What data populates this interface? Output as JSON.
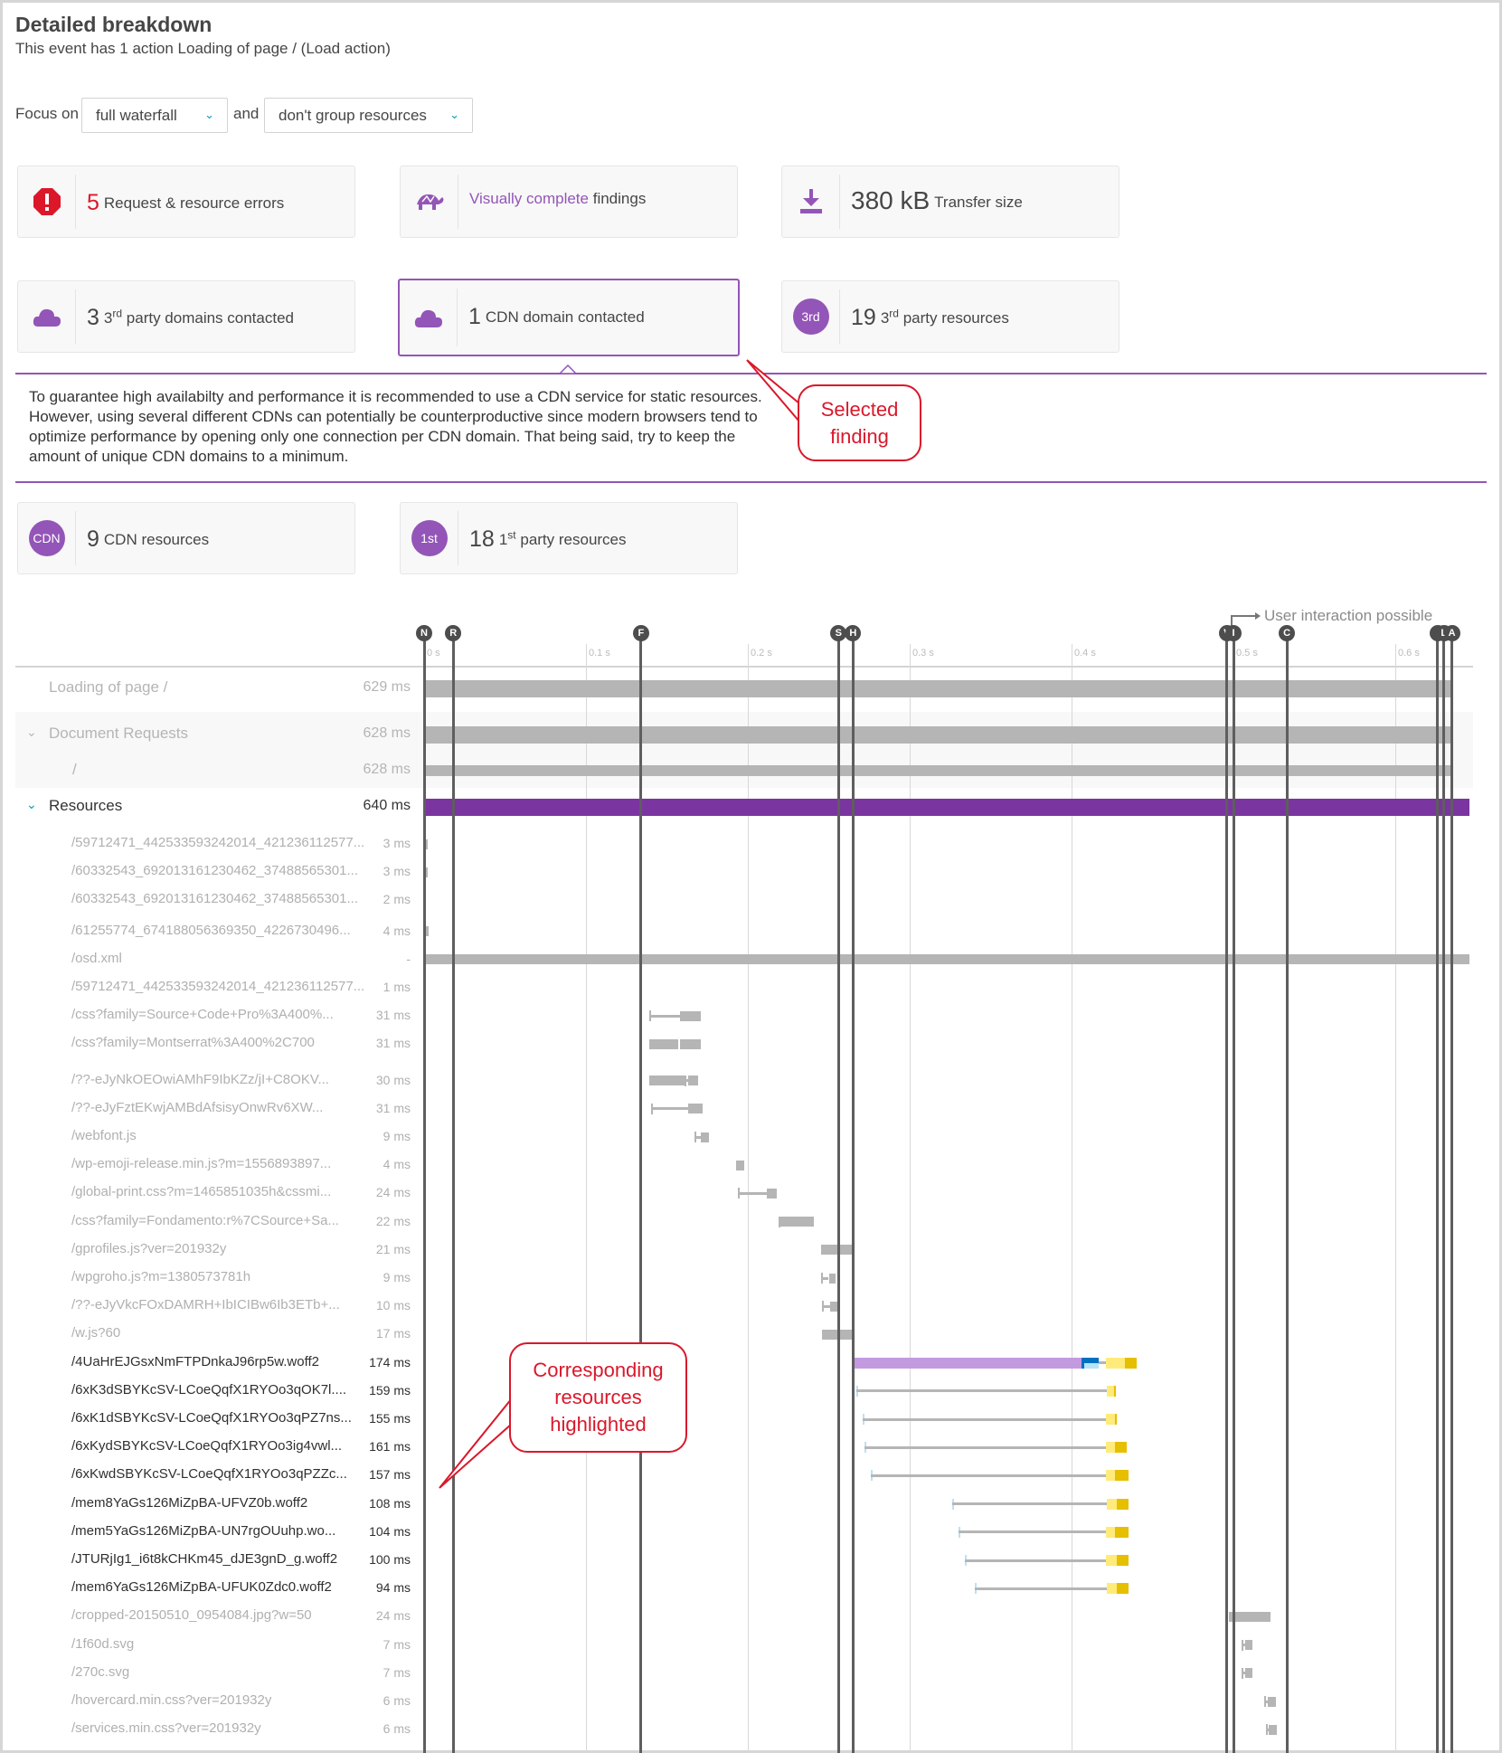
{
  "header": {
    "title": "Detailed breakdown",
    "subtitle": "This event has 1 action Loading of page / (Load action)"
  },
  "focus": {
    "label": "Focus on",
    "select1": "full waterfall",
    "and_label": "and",
    "select2": "don't group resources"
  },
  "cards": {
    "errors": {
      "value": "5",
      "label": "Request & resource errors",
      "icon": "error-octagon-icon"
    },
    "visually": {
      "link": "Visually complete",
      "label": "findings",
      "icon": "turtle-icon"
    },
    "transfer": {
      "value": "380 kB",
      "label": "Transfer size",
      "icon": "download-icon"
    },
    "third_domains": {
      "value": "3",
      "sup_num": "3",
      "sup": "rd",
      "label": "party domains contacted",
      "icon": "cloud-icon"
    },
    "cdn_domain": {
      "value": "1",
      "label": "CDN domain contacted",
      "icon": "cloud-icon",
      "selected": true
    },
    "third_resources": {
      "badge": "3rd",
      "value": "19",
      "sup_num": "3",
      "sup": "rd",
      "label": "party resources"
    },
    "cdn_resources": {
      "badge": "CDN",
      "value": "9",
      "label": "CDN resources"
    },
    "first_resources": {
      "badge": "1st",
      "value": "18",
      "sup_num": "1",
      "sup": "st",
      "label": "party resources"
    }
  },
  "finding_description": "To guarantee high availabilty and performance it is recommended to use a CDN service for static resources. However, using several different CDNs can potentially be counterproductive since modern browsers tend to optimize performance by opening only one connection per CDN domain. That being said, try to keep the amount of unique CDN domains to a minimum.",
  "callouts": {
    "selected": "Selected finding",
    "resources": "Corresponding resources highlighted"
  },
  "colors": {
    "accent": "#9355b7",
    "resources_bar": "#7b35a0",
    "error": "#dc172a",
    "highlight_bar": "#c39ae0",
    "blue": "#0070c0",
    "lightblue": "#b7e3f7",
    "yellow": "#ffeb7a",
    "gold": "#e6bf00",
    "gray": "#b5b5b5"
  },
  "waterfall": {
    "ticks": [
      "0 s",
      "0.1 s",
      "0.2 s",
      "0.3 s",
      "0.4 s",
      "0.5 s",
      "0.6 s"
    ],
    "tick_ms": [
      0,
      100,
      200,
      300,
      400,
      500,
      600
    ],
    "user_interaction": "User interaction possible",
    "markers": [
      {
        "label": "N",
        "ms": 0
      },
      {
        "label": "R",
        "ms": 18
      },
      {
        "label": "F",
        "ms": 134
      },
      {
        "label": "S",
        "ms": 256
      },
      {
        "label": "H",
        "ms": 265
      },
      {
        "label": "V",
        "ms": 496
      },
      {
        "label": "I",
        "ms": 500
      },
      {
        "label": "C",
        "ms": 533
      },
      {
        "label": "",
        "ms": 626
      },
      {
        "label": "L",
        "ms": 630
      },
      {
        "label": "A",
        "ms": 635
      }
    ],
    "summary": [
      {
        "name": "Loading of page /",
        "duration": "629 ms",
        "start": 0,
        "end": 635
      },
      {
        "name": "Document Requests",
        "duration": "628 ms",
        "start": 0,
        "end": 635,
        "expandable": true
      },
      {
        "name": "/",
        "duration": "628 ms",
        "start": 0,
        "end": 635
      },
      {
        "name": "Resources",
        "duration": "640 ms",
        "start": 0,
        "end": 646,
        "expandable": true
      }
    ],
    "resources": [
      {
        "name": "/59712471_442533593242014_421236112577...",
        "duration": "3 ms",
        "segments": [
          [
            "bar",
            0,
            2
          ]
        ]
      },
      {
        "name": "/60332543_692013161230462_37488565301...",
        "duration": "3 ms",
        "segments": [
          [
            "bar",
            0,
            2
          ]
        ]
      },
      {
        "name": "/60332543_692013161230462_37488565301...",
        "duration": "2 ms",
        "segments": [
          [
            "bar",
            0,
            1
          ]
        ]
      },
      {
        "name": "/61255774_674188056369350_4226730496...",
        "duration": "4 ms",
        "segments": [
          [
            "bar",
            0,
            3
          ]
        ]
      },
      {
        "name": "/osd.xml",
        "duration": "-",
        "segments": [
          [
            "bar",
            0,
            646
          ]
        ]
      },
      {
        "name": "/59712471_442533593242014_421236112577...",
        "duration": "1 ms",
        "segments": [
          [
            "bar",
            0,
            0.6
          ]
        ]
      },
      {
        "name": "/css?family=Source+Code+Pro%3A400%...",
        "duration": "31 ms",
        "segments": [
          [
            "line",
            139,
            158
          ],
          [
            "bar",
            158,
            171
          ]
        ]
      },
      {
        "name": "/css?family=Montserrat%3A400%2C700",
        "duration": "31 ms",
        "segments": [
          [
            "bar",
            139,
            157
          ],
          [
            "bar",
            158,
            171
          ]
        ]
      },
      {
        "name": "/??-eJyNkOEOwiAMhF9IbKZz/jI+C8OKV...",
        "duration": "30 ms",
        "segments": [
          [
            "bar",
            139,
            161
          ],
          [
            "line",
            161,
            163
          ],
          [
            "bar",
            163,
            169
          ]
        ]
      },
      {
        "name": "/??-eJyFztEKwjAMBdAfsisyOnwRv6XW...",
        "duration": "31 ms",
        "segments": [
          [
            "line",
            140,
            163
          ],
          [
            "bar",
            163,
            172
          ]
        ]
      },
      {
        "name": "/webfont.js",
        "duration": "9 ms",
        "segments": [
          [
            "line",
            167,
            171
          ],
          [
            "bar",
            171,
            176
          ]
        ]
      },
      {
        "name": "/wp-emoji-release.min.js?m=1556893897...",
        "duration": "4 ms",
        "segments": [
          [
            "bar",
            193,
            198
          ]
        ]
      },
      {
        "name": "/global-print.css?m=1465851035h&cssmi...",
        "duration": "24 ms",
        "segments": [
          [
            "line",
            194,
            212
          ],
          [
            "bar",
            212,
            218
          ]
        ]
      },
      {
        "name": "/css?family=Fondamento:r%7CSource+Sa...",
        "duration": "22 ms",
        "segments": [
          [
            "line",
            219,
            220
          ],
          [
            "bar",
            220,
            241
          ]
        ]
      },
      {
        "name": "/gprofiles.js?ver=201932y",
        "duration": "21 ms",
        "segments": [
          [
            "bar",
            245,
            266
          ]
        ]
      },
      {
        "name": "/wpgroho.js?m=1380573781h",
        "duration": "9 ms",
        "segments": [
          [
            "line",
            245,
            250
          ],
          [
            "bar",
            250,
            254
          ]
        ]
      },
      {
        "name": "/??-eJyVkcFOxDAMRH+IbICIBw6Ib3ETb+...",
        "duration": "10 ms",
        "segments": [
          [
            "line",
            246,
            251
          ],
          [
            "bar",
            251,
            257
          ]
        ]
      },
      {
        "name": "/w.js?60",
        "duration": "17 ms",
        "segments": [
          [
            "bar",
            246,
            264
          ]
        ]
      },
      {
        "name": "/4UaHrEJGsxNmFTPDnkaJ96rp5w.woff2",
        "duration": "174 ms",
        "highlighted": true,
        "segments": [
          [
            "purple",
            264,
            406
          ],
          [
            "blue",
            406,
            417
          ],
          [
            "lightblue",
            408,
            417
          ],
          [
            "line",
            417,
            421
          ],
          [
            "yellow",
            421,
            433
          ],
          [
            "gold",
            433,
            440
          ]
        ]
      },
      {
        "name": "/6xK3dSBYKcSV-LCoeQqfX1RYOo3qOK7l....",
        "duration": "159 ms",
        "highlighted": true,
        "segments": [
          [
            "tick",
            267,
            268
          ],
          [
            "line",
            267,
            422
          ],
          [
            "yellow",
            422,
            426
          ],
          [
            "gold",
            426,
            427.5
          ]
        ]
      },
      {
        "name": "/6xK1dSBYKcSV-LCoeQqfX1RYOo3qPZ7ns...",
        "duration": "155 ms",
        "highlighted": true,
        "segments": [
          [
            "tick",
            271,
            272
          ],
          [
            "line",
            271,
            421
          ],
          [
            "yellow",
            421,
            427
          ],
          [
            "gold",
            427,
            427.6
          ]
        ]
      },
      {
        "name": "/6xKydSBYKcSV-LCoeQqfX1RYOo3ig4vwl...",
        "duration": "161 ms",
        "highlighted": true,
        "segments": [
          [
            "tick",
            272,
            273
          ],
          [
            "line",
            272,
            421
          ],
          [
            "yellow",
            421,
            427
          ],
          [
            "gold",
            427,
            434
          ]
        ]
      },
      {
        "name": "/6xKwdSBYKcSV-LCoeQqfX1RYOo3qPZZc...",
        "duration": "157 ms",
        "highlighted": true,
        "segments": [
          [
            "tick",
            276,
            277
          ],
          [
            "line",
            276,
            421
          ],
          [
            "yellow",
            421,
            427
          ],
          [
            "gold",
            427,
            435
          ]
        ]
      },
      {
        "name": "/mem8YaGs126MiZpBA-UFVZ0b.woff2",
        "duration": "108 ms",
        "highlighted": true,
        "segments": [
          [
            "tick",
            326,
            327
          ],
          [
            "line",
            326,
            422
          ],
          [
            "yellow",
            422,
            428
          ],
          [
            "gold",
            428,
            435
          ]
        ]
      },
      {
        "name": "/mem5YaGs126MiZpBA-UN7rgOUuhp.wo...",
        "duration": "104 ms",
        "highlighted": true,
        "segments": [
          [
            "tick",
            330,
            331
          ],
          [
            "line",
            330,
            421
          ],
          [
            "yellow",
            421,
            427
          ],
          [
            "gold",
            427,
            435
          ]
        ]
      },
      {
        "name": "/JTURjIg1_i6t8kCHKm45_dJE3gnD_g.woff2",
        "duration": "100 ms",
        "highlighted": true,
        "segments": [
          [
            "tick",
            334,
            335
          ],
          [
            "line",
            334,
            421
          ],
          [
            "yellow",
            421,
            428
          ],
          [
            "gold",
            428,
            435
          ]
        ]
      },
      {
        "name": "/mem6YaGs126MiZpBA-UFUK0Zdc0.woff2",
        "duration": "94 ms",
        "highlighted": true,
        "segments": [
          [
            "tick",
            340,
            341
          ],
          [
            "line",
            340,
            422
          ],
          [
            "yellow",
            422,
            428
          ],
          [
            "gold",
            428,
            435
          ]
        ]
      },
      {
        "name": "/cropped-20150510_0954084.jpg?w=50",
        "duration": "24 ms",
        "segments": [
          [
            "bar",
            497,
            523
          ]
        ]
      },
      {
        "name": "/1f60d.svg",
        "duration": "7 ms",
        "segments": [
          [
            "line",
            505,
            507
          ],
          [
            "bar",
            507,
            512
          ]
        ]
      },
      {
        "name": "/270c.svg",
        "duration": "7 ms",
        "segments": [
          [
            "line",
            505,
            507
          ],
          [
            "bar",
            507,
            512
          ]
        ]
      },
      {
        "name": "/hovercard.min.css?ver=201932y",
        "duration": "6 ms",
        "segments": [
          [
            "line",
            519,
            521
          ],
          [
            "bar",
            521,
            526
          ]
        ]
      },
      {
        "name": "/services.min.css?ver=201932y",
        "duration": "6 ms",
        "segments": [
          [
            "line",
            520,
            522
          ],
          [
            "bar",
            522,
            527
          ]
        ]
      }
    ]
  }
}
